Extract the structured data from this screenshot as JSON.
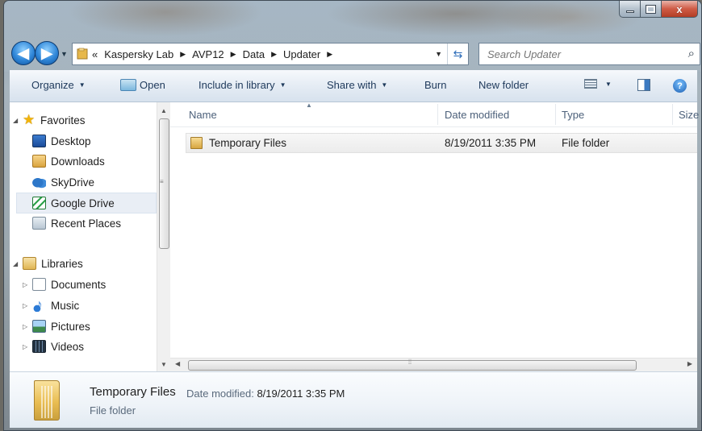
{
  "window": {
    "caption_buttons": {
      "minimize": "—",
      "maximize": "□",
      "close": "x"
    }
  },
  "nav": {
    "back_icon": "◀",
    "forward_icon": "▶",
    "address": {
      "prefix": "«",
      "crumbs": [
        "Kaspersky Lab",
        "AVP12",
        "Data",
        "Updater"
      ]
    },
    "search_placeholder": "Search Updater"
  },
  "toolbar": {
    "organize": "Organize",
    "open": "Open",
    "include_in_library": "Include in library",
    "share_with": "Share with",
    "burn": "Burn",
    "new_folder": "New folder"
  },
  "sidebar": {
    "favorites": {
      "label": "Favorites",
      "items": [
        "Desktop",
        "Downloads",
        "SkyDrive",
        "Google Drive",
        "Recent Places"
      ],
      "selected": "Google Drive"
    },
    "libraries": {
      "label": "Libraries",
      "items": [
        "Documents",
        "Music",
        "Pictures",
        "Videos"
      ]
    }
  },
  "columns": {
    "name": "Name",
    "date_modified": "Date modified",
    "type": "Type",
    "size": "Size"
  },
  "files": [
    {
      "name": "Temporary Files",
      "date_modified": "8/19/2011 3:35 PM",
      "type": "File folder"
    }
  ],
  "details": {
    "name": "Temporary Files",
    "date_label": "Date modified:",
    "date_value": "8/19/2011 3:35 PM",
    "type": "File folder"
  },
  "colors": {
    "toolbar_text": "#1e395b",
    "header_text": "#4c607a",
    "selection": "#e9eef5"
  }
}
